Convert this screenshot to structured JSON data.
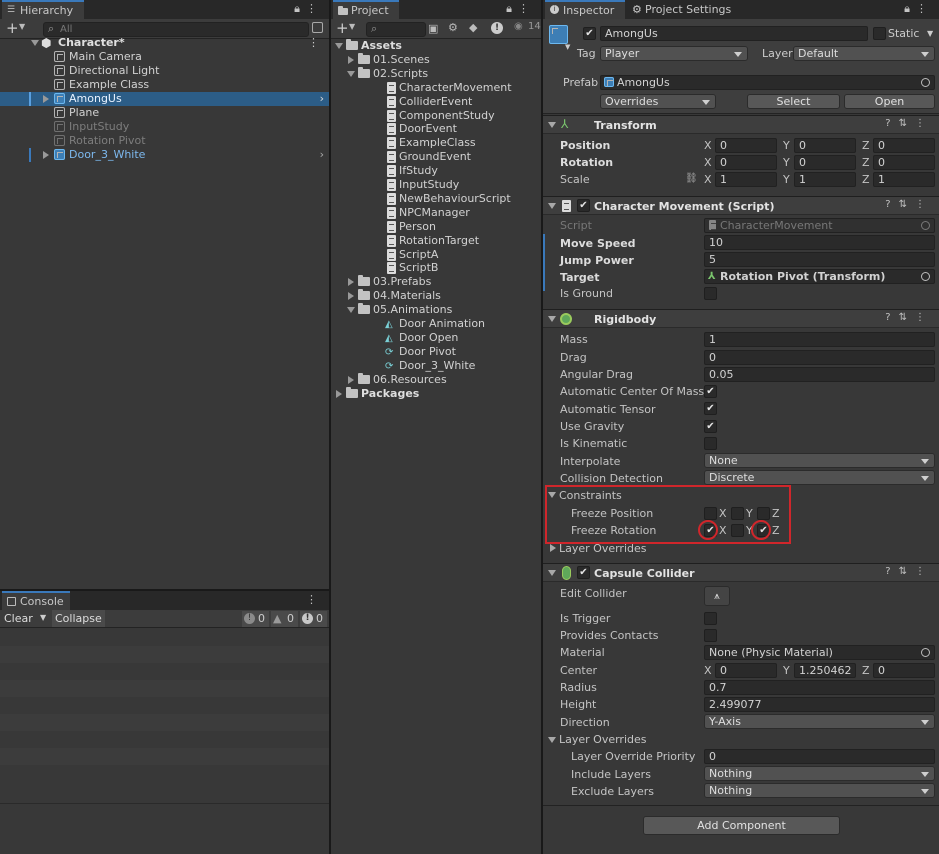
{
  "hierarchy": {
    "tab": "Hierarchy",
    "search_placeholder": "All",
    "add_label": "+",
    "items": [
      {
        "label": "Character*",
        "expanded": true
      },
      {
        "label": "Main Camera"
      },
      {
        "label": "Directional Light"
      },
      {
        "label": "Example Class"
      },
      {
        "label": "AmongUs",
        "selected": true
      },
      {
        "label": "Plane"
      },
      {
        "label": "InputStudy",
        "disabled": true
      },
      {
        "label": "Rotation Pivot",
        "disabled": true
      },
      {
        "label": "Door_3_White",
        "prefab": true
      }
    ]
  },
  "console": {
    "tab": "Console",
    "clear": "Clear",
    "collapse": "Collapse",
    "log_count": "0",
    "warn_count": "0",
    "error_count": "0"
  },
  "project": {
    "tab": "Project",
    "add_label": "+",
    "hidden_count": "14",
    "items": [
      {
        "label": "Assets",
        "type": "folder",
        "depth": 0,
        "open": true,
        "bold": true
      },
      {
        "label": "01.Scenes",
        "type": "folder",
        "depth": 1,
        "open": false
      },
      {
        "label": "02.Scripts",
        "type": "folder",
        "depth": 1,
        "open": true
      },
      {
        "label": "CharacterMovement",
        "type": "script",
        "depth": 2
      },
      {
        "label": "ColliderEvent",
        "type": "script",
        "depth": 2
      },
      {
        "label": "ComponentStudy",
        "type": "script",
        "depth": 2
      },
      {
        "label": "DoorEvent",
        "type": "script",
        "depth": 2
      },
      {
        "label": "ExampleClass",
        "type": "script",
        "depth": 2
      },
      {
        "label": "GroundEvent",
        "type": "script",
        "depth": 2
      },
      {
        "label": "IfStudy",
        "type": "script",
        "depth": 2
      },
      {
        "label": "InputStudy",
        "type": "script",
        "depth": 2
      },
      {
        "label": "NewBehaviourScript",
        "type": "script",
        "depth": 2
      },
      {
        "label": "NPCManager",
        "type": "script",
        "depth": 2
      },
      {
        "label": "Person",
        "type": "script",
        "depth": 2
      },
      {
        "label": "RotationTarget",
        "type": "script",
        "depth": 2
      },
      {
        "label": "ScriptA",
        "type": "script",
        "depth": 2
      },
      {
        "label": "ScriptB",
        "type": "script",
        "depth": 2
      },
      {
        "label": "03.Prefabs",
        "type": "folder",
        "depth": 1,
        "open": false
      },
      {
        "label": "04.Materials",
        "type": "folder",
        "depth": 1,
        "open": false
      },
      {
        "label": "05.Animations",
        "type": "folder",
        "depth": 1,
        "open": true
      },
      {
        "label": "Door Animation",
        "type": "anim",
        "depth": 2
      },
      {
        "label": "Door Open",
        "type": "anim",
        "depth": 2
      },
      {
        "label": "Door Pivot",
        "type": "controller",
        "depth": 2
      },
      {
        "label": "Door_3_White",
        "type": "controller",
        "depth": 2
      },
      {
        "label": "06.Resources",
        "type": "folder",
        "depth": 1,
        "open": false
      },
      {
        "label": "Packages",
        "type": "folder",
        "depth": 0,
        "open": false,
        "bold": true
      }
    ]
  },
  "inspector": {
    "tabs": [
      "Inspector",
      "Project Settings"
    ],
    "object_name": "AmongUs",
    "static_label": "Static",
    "tag_label": "Tag",
    "tag_value": "Player",
    "layer_label": "Layer",
    "layer_value": "Default",
    "prefab_label": "Prefab",
    "prefab_value": "AmongUs",
    "overrides": "Overrides",
    "select": "Select",
    "open": "Open",
    "transform": {
      "title": "Transform",
      "position_label": "Position",
      "rotation_label": "Rotation",
      "scale_label": "Scale",
      "position": [
        "0",
        "0",
        "0"
      ],
      "rotation": [
        "0",
        "0",
        "0"
      ],
      "scale": [
        "1",
        "1",
        "1"
      ]
    },
    "xyz": [
      "X",
      "Y",
      "Z"
    ],
    "charmove": {
      "title": "Character Movement (Script)",
      "script_label": "Script",
      "script_value": "CharacterMovement",
      "move_speed_label": "Move Speed",
      "move_speed": "10",
      "jump_power_label": "Jump Power",
      "jump_power": "5",
      "target_label": "Target",
      "target_value": "Rotation Pivot (Transform)",
      "is_ground_label": "Is Ground"
    },
    "rigidbody": {
      "title": "Rigidbody",
      "mass_label": "Mass",
      "mass": "1",
      "drag_label": "Drag",
      "drag": "0",
      "angular_drag_label": "Angular Drag",
      "angular_drag": "0.05",
      "auto_com_label": "Automatic Center Of Mass",
      "auto_tensor_label": "Automatic Tensor",
      "use_gravity_label": "Use Gravity",
      "is_kinematic_label": "Is Kinematic",
      "interpolate_label": "Interpolate",
      "interpolate": "None",
      "collision_label": "Collision Detection",
      "collision": "Discrete",
      "constraints_label": "Constraints",
      "freeze_pos_label": "Freeze Position",
      "freeze_rot_label": "Freeze Rotation",
      "layer_overrides_label": "Layer Overrides"
    },
    "capsule": {
      "title": "Capsule Collider",
      "edit_collider_label": "Edit Collider",
      "is_trigger_label": "Is Trigger",
      "provides_contacts_label": "Provides Contacts",
      "material_label": "Material",
      "material": "None (Physic Material)",
      "center_label": "Center",
      "center": [
        "0",
        "1.250462",
        "0"
      ],
      "radius_label": "Radius",
      "radius": "0.7",
      "height_label": "Height",
      "height": "2.499077",
      "direction_label": "Direction",
      "direction": "Y-Axis",
      "layer_overrides_label": "Layer Overrides",
      "priority_label": "Layer Override Priority",
      "priority": "0",
      "include_label": "Include Layers",
      "include": "Nothing",
      "exclude_label": "Exclude Layers",
      "exclude": "Nothing"
    },
    "add_component": "Add Component"
  }
}
